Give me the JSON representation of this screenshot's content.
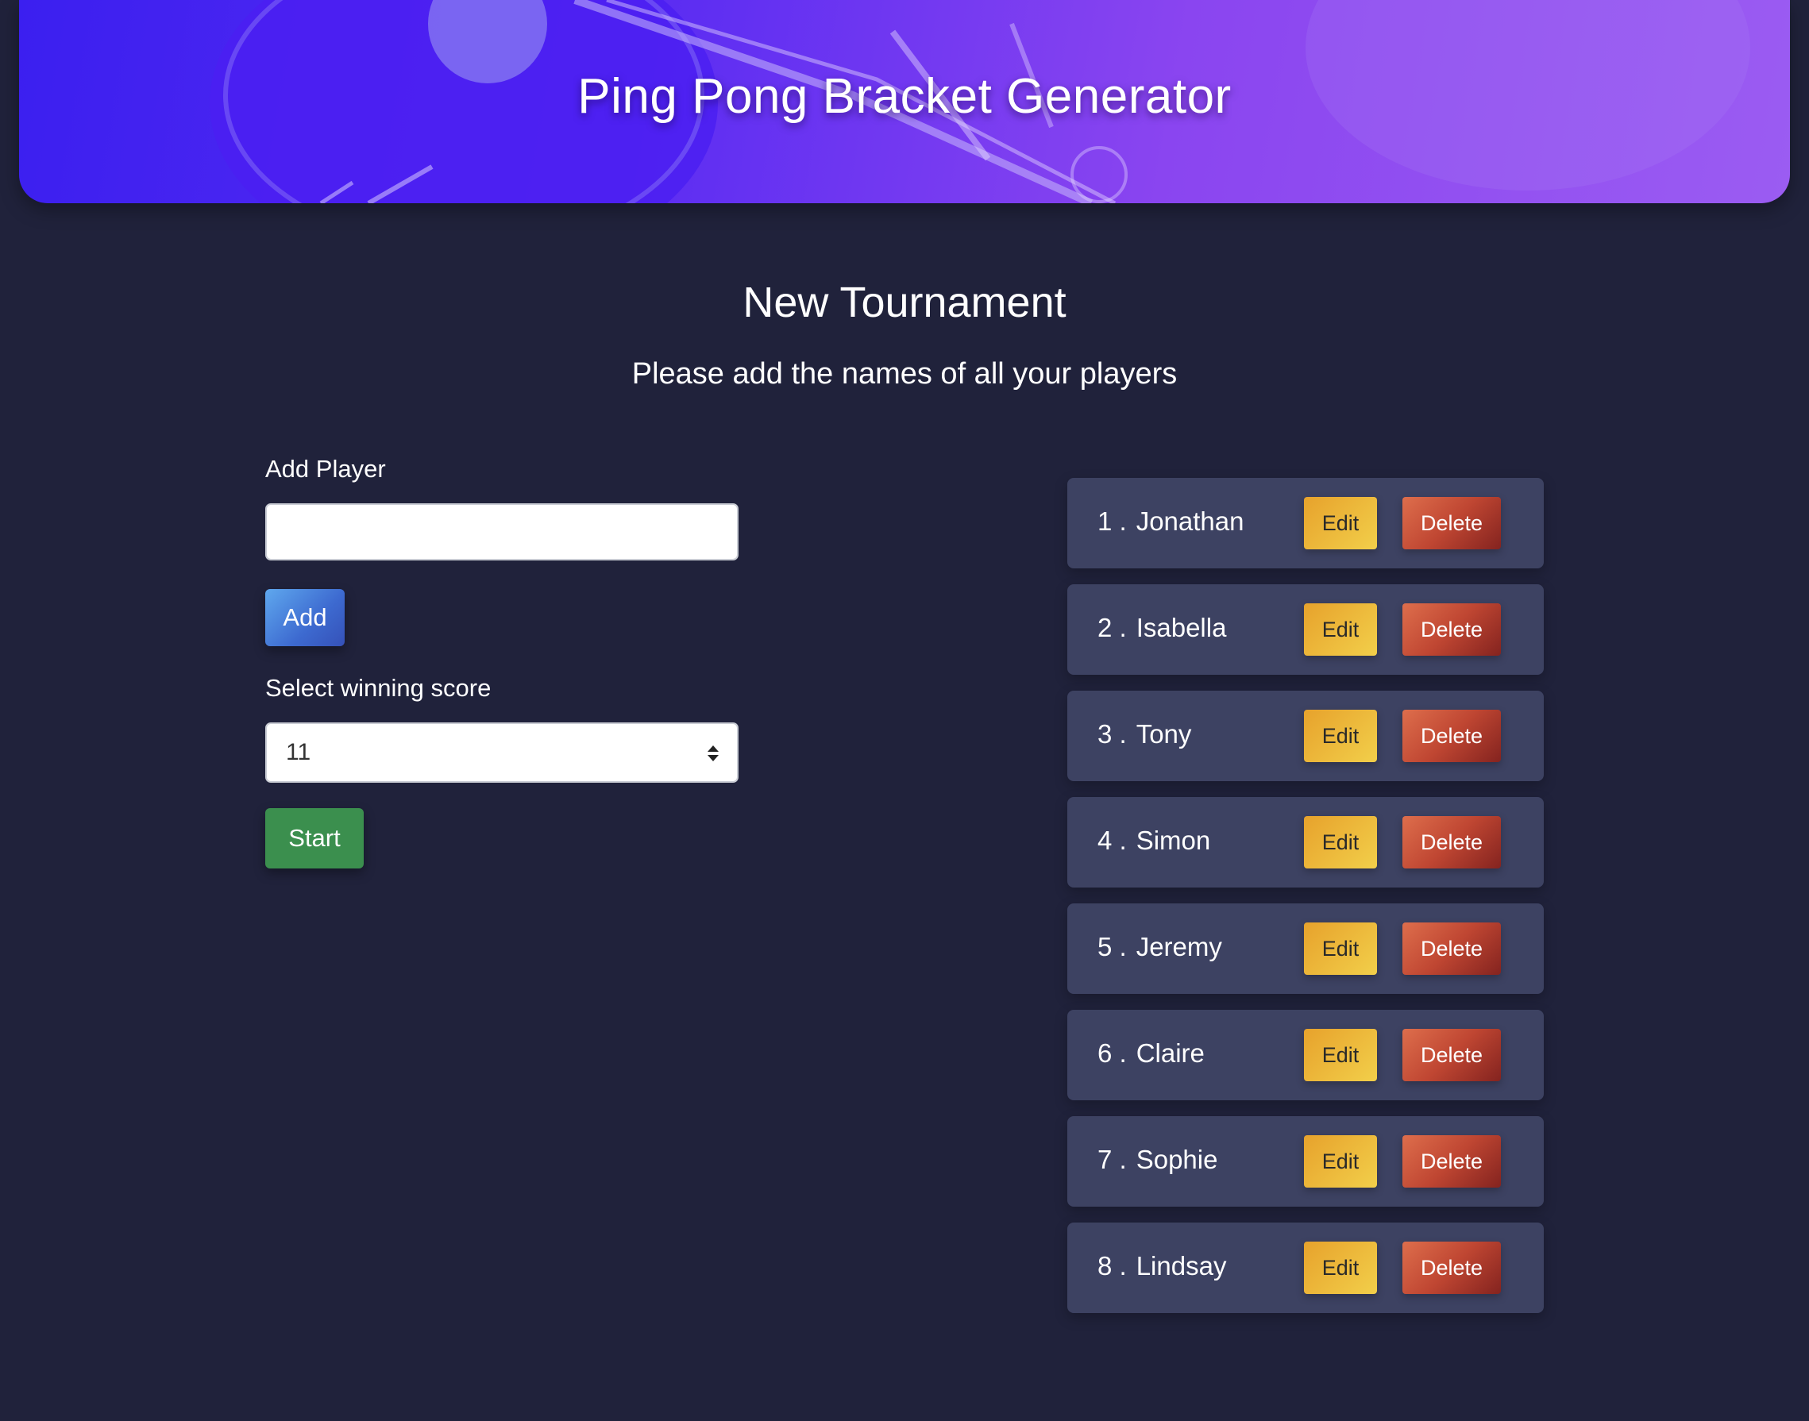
{
  "header": {
    "title": "Ping Pong Bracket Generator"
  },
  "main": {
    "title": "New Tournament",
    "subtitle": "Please add the names of all your players"
  },
  "form": {
    "add_player_label": "Add Player",
    "add_player_value": "",
    "add_button_label": "Add",
    "winning_score_label": "Select winning score",
    "winning_score_value": "11",
    "start_button_label": "Start"
  },
  "players": [
    {
      "number": "1 .",
      "name": "Jonathan",
      "edit_label": "Edit",
      "delete_label": "Delete"
    },
    {
      "number": "2 .",
      "name": "Isabella",
      "edit_label": "Edit",
      "delete_label": "Delete"
    },
    {
      "number": "3 .",
      "name": "Tony",
      "edit_label": "Edit",
      "delete_label": "Delete"
    },
    {
      "number": "4 .",
      "name": "Simon",
      "edit_label": "Edit",
      "delete_label": "Delete"
    },
    {
      "number": "5 .",
      "name": "Jeremy",
      "edit_label": "Edit",
      "delete_label": "Delete"
    },
    {
      "number": "6 .",
      "name": "Claire",
      "edit_label": "Edit",
      "delete_label": "Delete"
    },
    {
      "number": "7 .",
      "name": "Sophie",
      "edit_label": "Edit",
      "delete_label": "Delete"
    },
    {
      "number": "8 .",
      "name": "Lindsay",
      "edit_label": "Edit",
      "delete_label": "Delete"
    }
  ],
  "colors": {
    "background": "#20223b",
    "header_gradient_start": "#3b1ff0",
    "header_gradient_end": "#9b5cf2",
    "row_background": "#3d4262",
    "add_button": "#3d6ad0",
    "start_button": "#3b8f4e",
    "edit_button": "#f2cf4a",
    "delete_button": "#bf4632"
  }
}
